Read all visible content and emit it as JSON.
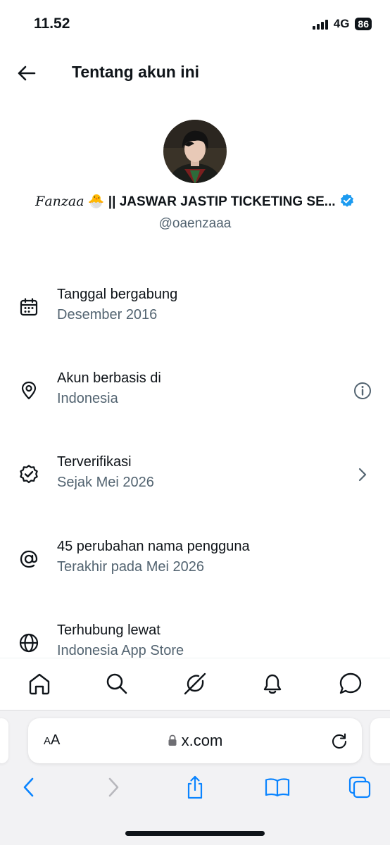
{
  "status_bar": {
    "time": "11.52",
    "network": "4G",
    "battery": "86"
  },
  "header": {
    "title": "Tentang akun ini"
  },
  "profile": {
    "name_script": "𝐹𝑎𝑛𝑧𝑎𝑎",
    "name_emoji": "🐣",
    "name_rest": "|| JASWAR JASTIP TICKETING SE...",
    "handle": "@oaenzaaa",
    "verified_color": "#1d9bf0"
  },
  "details": [
    {
      "icon": "calendar-icon",
      "title": "Tanggal bergabung",
      "subtitle": "Desember 2016"
    },
    {
      "icon": "location-pin-icon",
      "title": "Akun berbasis di",
      "subtitle": "Indonesia",
      "trailing": "info-icon"
    },
    {
      "icon": "verified-badge-icon",
      "title": "Terverifikasi",
      "subtitle": "Sejak Mei 2026",
      "trailing": "chevron-right-icon"
    },
    {
      "icon": "at-sign-icon",
      "title": "45 perubahan nama pengguna",
      "subtitle": "Terakhir pada Mei 2026"
    },
    {
      "icon": "globe-icon",
      "title": "Terhubung lewat",
      "subtitle": "Indonesia App Store"
    }
  ],
  "bottom_nav": [
    "home-icon",
    "search-icon",
    "grok-icon",
    "notifications-bell-icon",
    "messages-icon"
  ],
  "browser": {
    "text_size_label_small": "A",
    "text_size_label_large": "A",
    "url": "x.com"
  },
  "colors": {
    "text": "#0f1419",
    "secondary": "#536471",
    "accent": "#1d9bf0",
    "safari_blue": "#0a84ff"
  }
}
